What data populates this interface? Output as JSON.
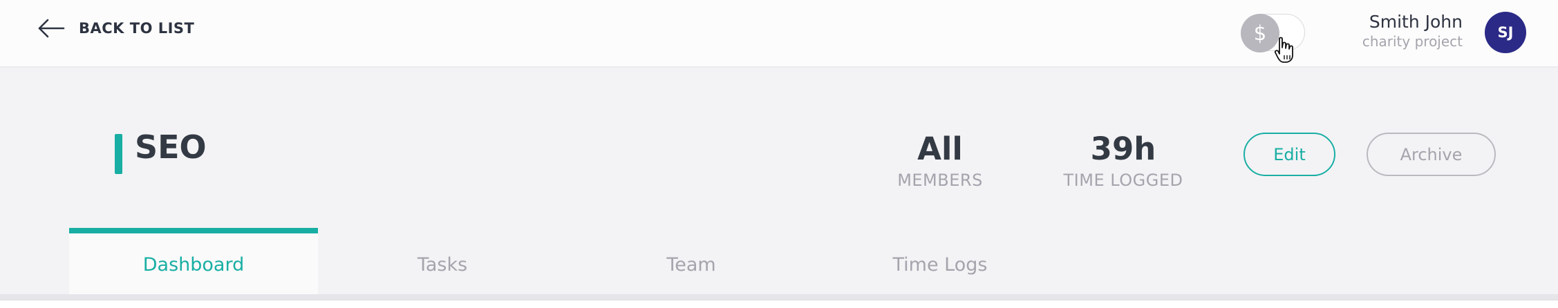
{
  "topbar": {
    "back_label": "BACK TO LIST",
    "toggle_symbol": "$",
    "user_name": "Smith John",
    "user_project": "charity project",
    "avatar_initials": "SJ"
  },
  "project": {
    "title": "SEO",
    "members_value": "All",
    "members_label": "MEMBERS",
    "time_value": "39h",
    "time_label": "TIME LOGGED",
    "edit_label": "Edit",
    "archive_label": "Archive"
  },
  "tabs": [
    {
      "label": "Dashboard",
      "active": true
    },
    {
      "label": "Tasks",
      "active": false
    },
    {
      "label": "Team",
      "active": false
    },
    {
      "label": "Time Logs",
      "active": false
    }
  ],
  "icons": {
    "back": "arrow-left-icon",
    "cursor": "hand-pointer-icon"
  },
  "colors": {
    "accent": "#18aea4",
    "avatar_bg": "#2b2a86",
    "toggle_knob": "#b7b7bd",
    "muted_text": "#a4a4ad",
    "primary_text": "#333a44"
  }
}
